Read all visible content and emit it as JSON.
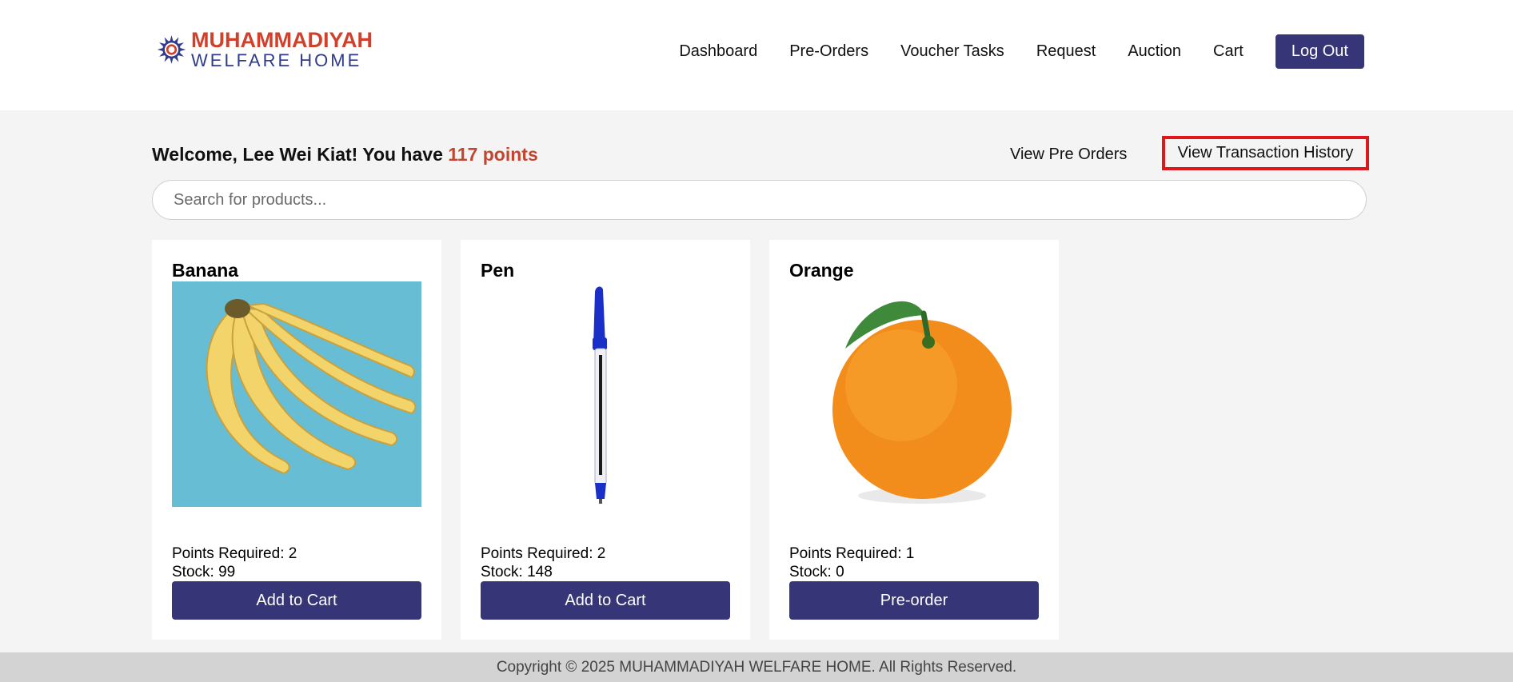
{
  "header": {
    "logo": {
      "line1": "MUHAMMADIYAH",
      "line2": "WELFARE HOME"
    },
    "nav": [
      "Dashboard",
      "Pre-Orders",
      "Voucher Tasks",
      "Request",
      "Auction",
      "Cart"
    ],
    "logout_label": "Log Out"
  },
  "welcome": {
    "prefix": "Welcome, Lee Wei Kiat! You have ",
    "points": "117 points"
  },
  "links": {
    "view_pre_orders": "View Pre Orders",
    "view_transaction_history": "View Transaction History"
  },
  "search": {
    "placeholder": "Search for products..."
  },
  "products": [
    {
      "name": "Banana",
      "points_required": "Points Required: 2",
      "stock": "Stock: 99",
      "action": "Add to Cart"
    },
    {
      "name": "Pen",
      "points_required": "Points Required: 2",
      "stock": "Stock: 148",
      "action": "Add to Cart"
    },
    {
      "name": "Orange",
      "points_required": "Points Required: 1",
      "stock": "Stock: 0",
      "action": "Pre-order"
    }
  ],
  "footer": {
    "text": "Copyright © 2025 MUHAMMADIYAH WELFARE HOME. All Rights Reserved."
  },
  "colors": {
    "brand": "#353577",
    "accent": "#c4452f",
    "highlight": "#e0161b"
  }
}
